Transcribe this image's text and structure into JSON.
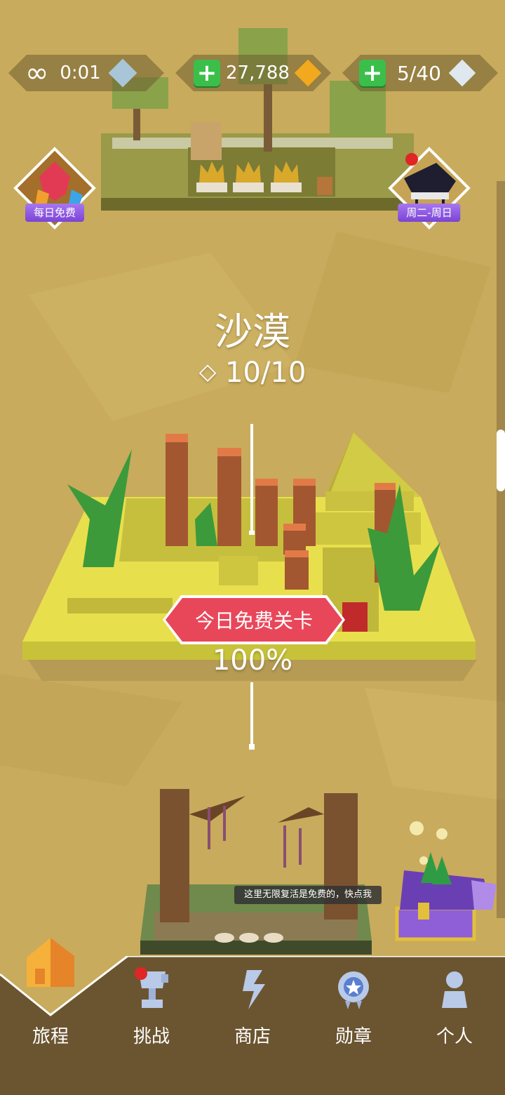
{
  "hud": {
    "time": "0:01",
    "coins": "27,788",
    "hearts": "5/40"
  },
  "badges": {
    "daily_free": "每日免费",
    "piano_schedule": "周二-周日"
  },
  "level": {
    "name": "沙漠",
    "gems": "10/10",
    "progress": "100%",
    "free_today": "今日免费关卡"
  },
  "tooltip": "这里无限复活是免费的，快点我",
  "nav": {
    "items": [
      {
        "label": "旅程"
      },
      {
        "label": "挑战"
      },
      {
        "label": "商店"
      },
      {
        "label": "勋章"
      },
      {
        "label": "个人"
      }
    ]
  },
  "colors": {
    "background": "#c8ab5c",
    "navbar": "#6b5530",
    "banner": "#e8475a",
    "badge_label": "#8b55e0",
    "plus_green": "#3bbf4a"
  }
}
